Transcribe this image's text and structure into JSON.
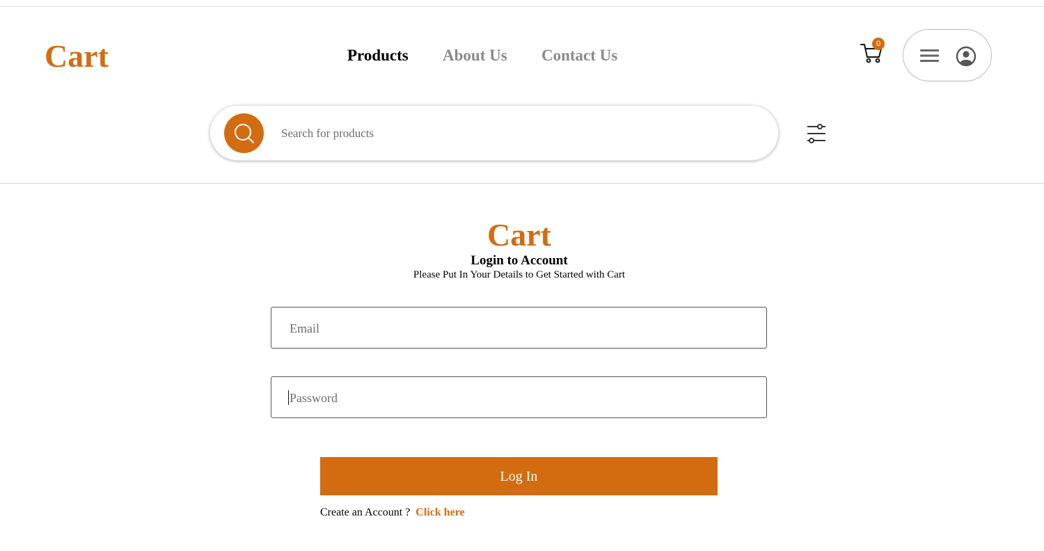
{
  "header": {
    "logo": "Cart",
    "nav": [
      {
        "label": "Products",
        "active": true
      },
      {
        "label": "About Us",
        "active": false
      },
      {
        "label": "Contact Us",
        "active": false
      }
    ],
    "cart_count": "0",
    "icons": {
      "cart": "shopping-cart-icon",
      "menu": "hamburger-menu-icon",
      "account": "user-circle-icon",
      "filter": "sliders-filter-icon",
      "search": "search-icon"
    }
  },
  "search": {
    "placeholder": "Search for products",
    "value": ""
  },
  "login": {
    "logo": "Cart",
    "title": "Login to Account",
    "subtitle": "Please Put In Your Details to Get Started with Cart",
    "email_placeholder": "Email",
    "password_placeholder": "Password",
    "submit_label": "Log In",
    "signup_prompt": "Create an Account ?",
    "signup_link": "Click here"
  },
  "colors": {
    "accent": "#d36c10",
    "nav_inactive": "#8a8a8a",
    "text": "#000000"
  }
}
